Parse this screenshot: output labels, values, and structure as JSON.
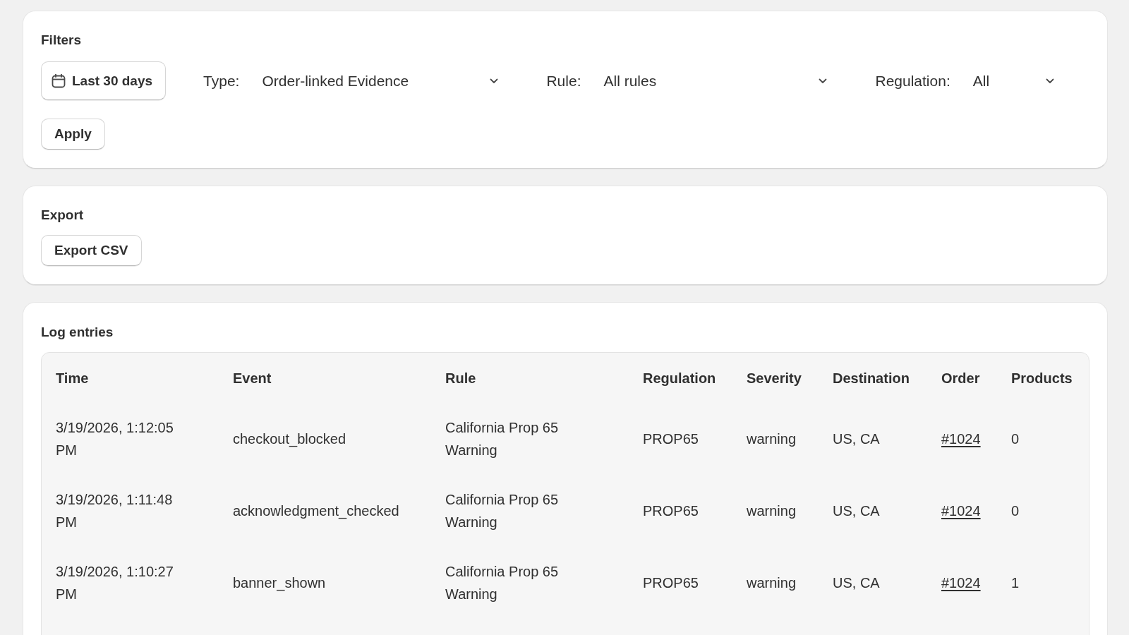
{
  "filters": {
    "title": "Filters",
    "date_button": {
      "label": "Last 30 days"
    },
    "selects": [
      {
        "label": "Type:",
        "value": "Order-linked Evidence"
      },
      {
        "label": "Rule:",
        "value": "All rules"
      },
      {
        "label": "Regulation:",
        "value": "All"
      }
    ],
    "apply_button": {
      "label": "Apply"
    }
  },
  "export": {
    "title": "Export",
    "button": {
      "label": "Export CSV"
    }
  },
  "log_entries": {
    "title": "Log entries",
    "table": {
      "columns": [
        "Time",
        "Event",
        "Rule",
        "Regulation",
        "Severity",
        "Destination",
        "Order",
        "Products"
      ],
      "rows": [
        {
          "time": "3/19/2026, 1:12:05 PM",
          "event": "checkout_blocked",
          "rule": "California Prop 65 Warning",
          "regulation": "PROP65",
          "severity": "warning",
          "destination": "US, CA",
          "order": "#1024",
          "products": "0"
        },
        {
          "time": "3/19/2026, 1:11:48 PM",
          "event": "acknowledgment_checked",
          "rule": "California Prop 65 Warning",
          "regulation": "PROP65",
          "severity": "warning",
          "destination": "US, CA",
          "order": "#1024",
          "products": "0"
        },
        {
          "time": "3/19/2026, 1:10:27 PM",
          "event": "banner_shown",
          "rule": "California Prop 65 Warning",
          "regulation": "PROP65",
          "severity": "warning",
          "destination": "US, CA",
          "order": "#1024",
          "products": "1"
        }
      ]
    }
  }
}
